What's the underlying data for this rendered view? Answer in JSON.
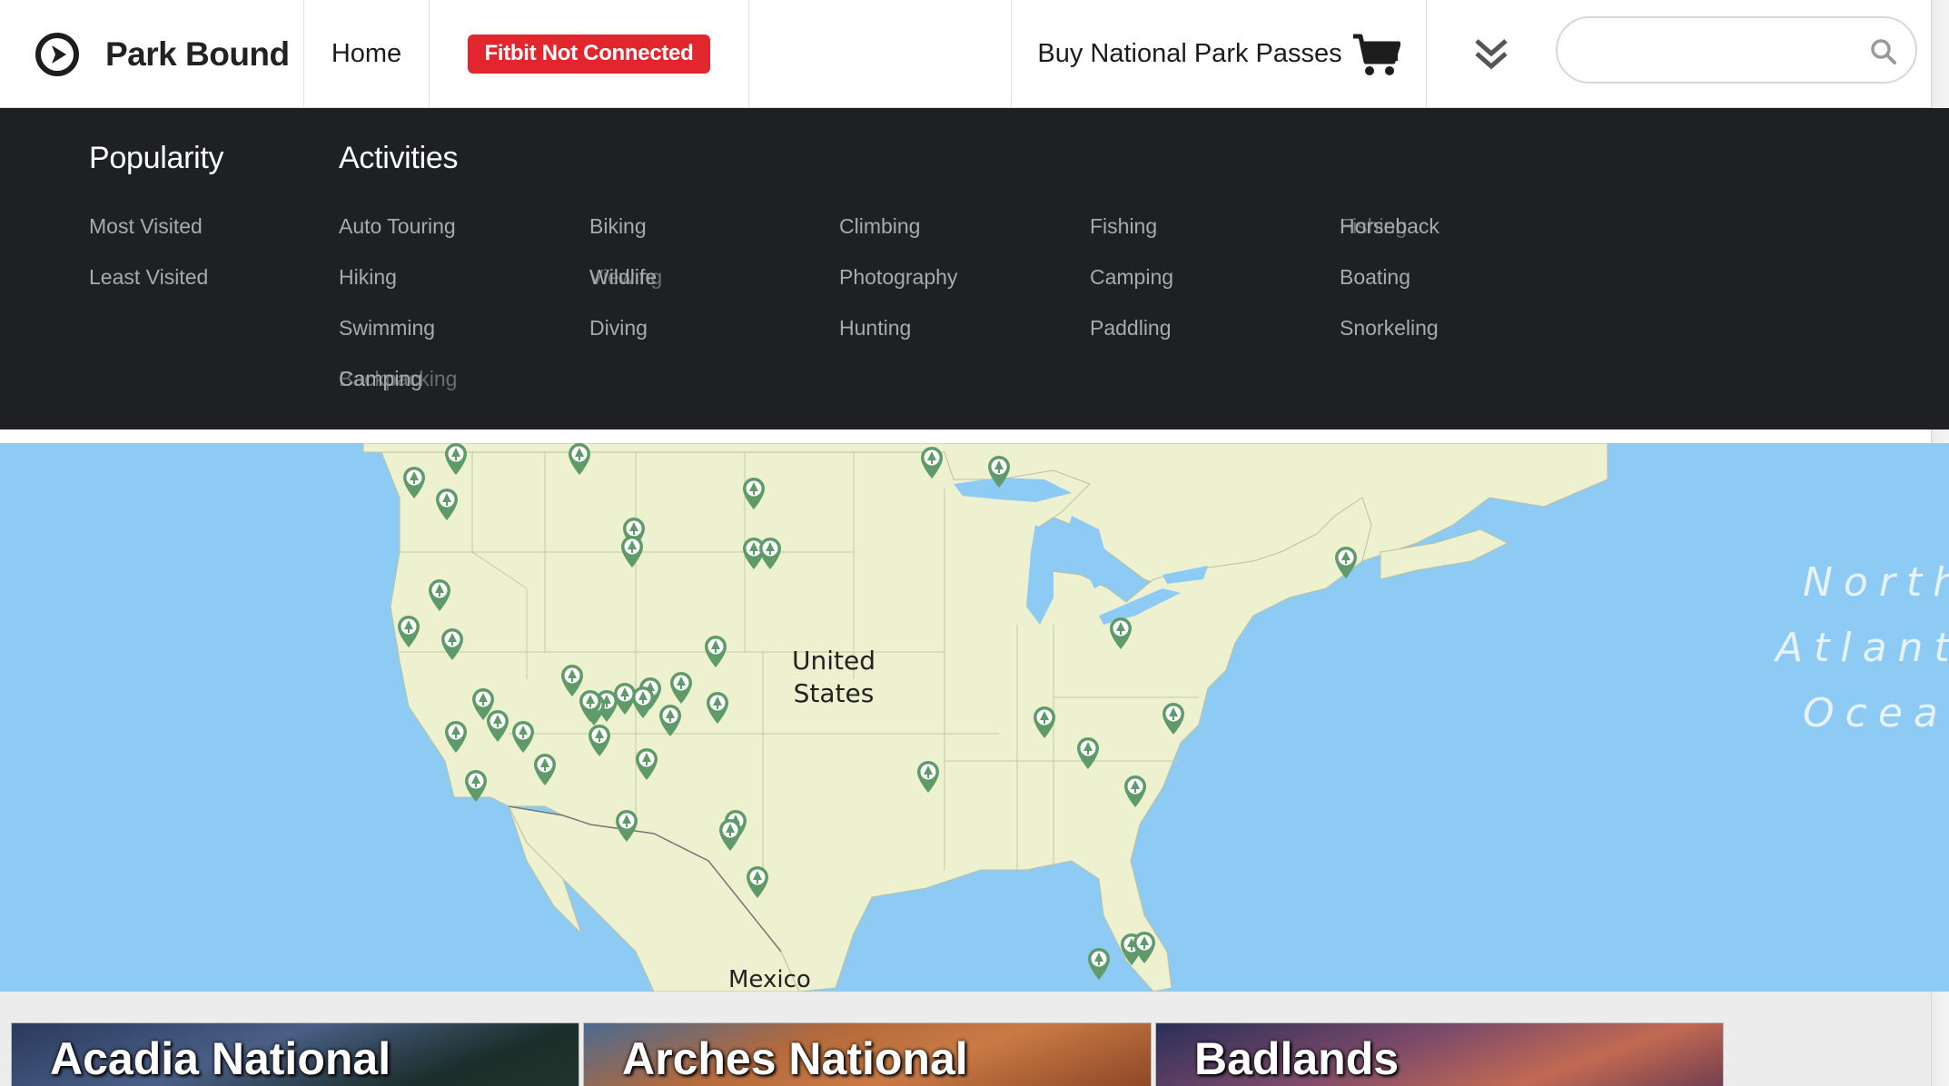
{
  "app": {
    "brand_name": "Park Bound",
    "logo_icon": "compass-icon"
  },
  "topnav": {
    "home_label": "Home",
    "fitbit_label": "Fitbit Not Connected",
    "buy_label": "Buy National Park Passes",
    "cart_icon": "cart-icon",
    "expand_icon": "double-chevron-down-icon",
    "search_placeholder": "",
    "search_icon": "search-icon"
  },
  "colors": {
    "fitbit_badge": "#e1262d",
    "menu_bg": "#1f2023",
    "ocean": "#8ecbf4",
    "land": "#eef1cf",
    "pin": "#5f9a6a"
  },
  "menu": {
    "popularity": {
      "heading": "Popularity",
      "items": [
        "Most Visited",
        "Least Visited"
      ]
    },
    "activities": {
      "heading": "Activities",
      "items": [
        "Auto Touring",
        "Biking",
        "Climbing",
        "Fishing",
        "Horseback",
        "Hiking",
        "Wildlife",
        "Photography",
        "Camping",
        "Boating",
        "Swimming",
        "Diving",
        "Hunting",
        "Paddling",
        "Snorkeling",
        "Camping"
      ],
      "overlap_items": [
        "Fishing",
        "Viewing",
        "Backpacking"
      ]
    }
  },
  "map": {
    "labels": {
      "country": [
        "United",
        "States"
      ],
      "mexico": "Mexico",
      "ocean": [
        "North",
        "Atlanti",
        "Ocean"
      ]
    },
    "pin_icon": "park-pin-icon"
  },
  "cards": [
    {
      "title": "Acadia National"
    },
    {
      "title": "Arches National"
    },
    {
      "title": "Badlands"
    }
  ]
}
